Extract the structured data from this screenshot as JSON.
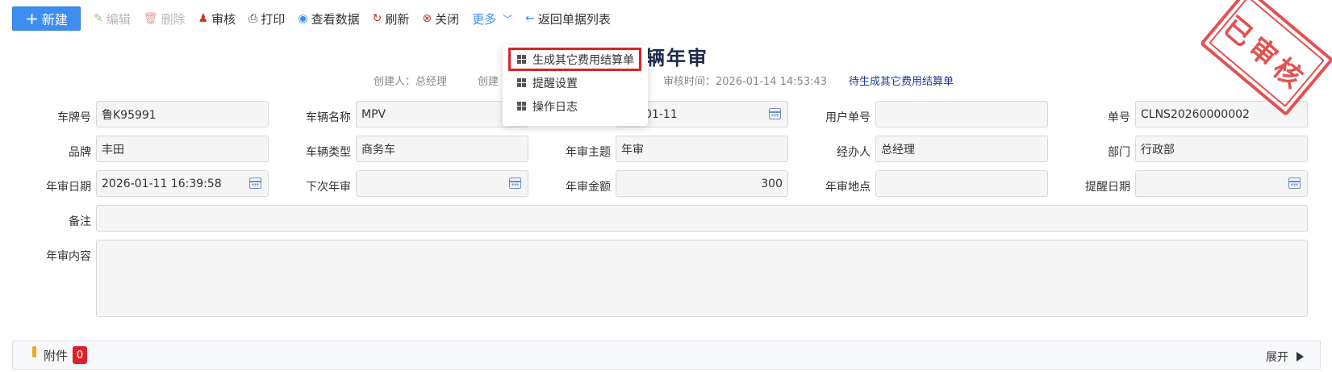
{
  "toolbar": {
    "new_label": "新建",
    "edit_label": "编辑",
    "delete_label": "删除",
    "audit_label": "审核",
    "print_label": "打印",
    "view_label": "查看数据",
    "refresh_label": "刷新",
    "close_label": "关闭",
    "more_label": "更多",
    "back_label": "返回单据列表"
  },
  "dropdown": {
    "items": [
      {
        "label": "生成其它费用结算单",
        "selected": true
      },
      {
        "label": "提醒设置"
      },
      {
        "label": "操作日志"
      }
    ]
  },
  "header": {
    "title_fragment": "辆年审",
    "creator": "创建人：总经理",
    "create_time_fragment": "创建",
    "audit_time": "审核时间：2026-01-14 14:53:43",
    "next_action": "待生成其它费用结算单"
  },
  "form": {
    "plate_label": "车牌号",
    "plate_value": "鲁K95991",
    "vehicle_name_label": "车辆名称",
    "vehicle_name_value": "MPV",
    "date_fragment": "-01-11",
    "user_no_label": "用户单号",
    "user_no_value": "",
    "doc_no_label": "单号",
    "doc_no_value": "CLNS20260000002",
    "brand_label": "品牌",
    "brand_value": "丰田",
    "vehicle_type_label": "车辆类型",
    "vehicle_type_value": "商务车",
    "subject_label": "年审主题",
    "subject_value": "年审",
    "handler_label": "经办人",
    "handler_value": "总经理",
    "dept_label": "部门",
    "dept_value": "行政部",
    "audit_date_label": "年审日期",
    "audit_date_value": "2026-01-11 16:39:58",
    "next_audit_label": "下次年审",
    "next_audit_value": "",
    "amount_label": "年审金额",
    "amount_value": "300",
    "location_label": "年审地点",
    "location_value": "",
    "remind_date_label": "提醒日期",
    "remind_date_value": "",
    "remark_label": "备注",
    "remark_value": "",
    "content_label": "年审内容",
    "content_value": ""
  },
  "attachment": {
    "label": "附件",
    "count": "0",
    "expand_label": "展开"
  },
  "stamp": {
    "text": "已审核"
  },
  "colors": {
    "primary": "#3d8ef0",
    "danger": "#d9232a",
    "stamp": "#e04040"
  }
}
